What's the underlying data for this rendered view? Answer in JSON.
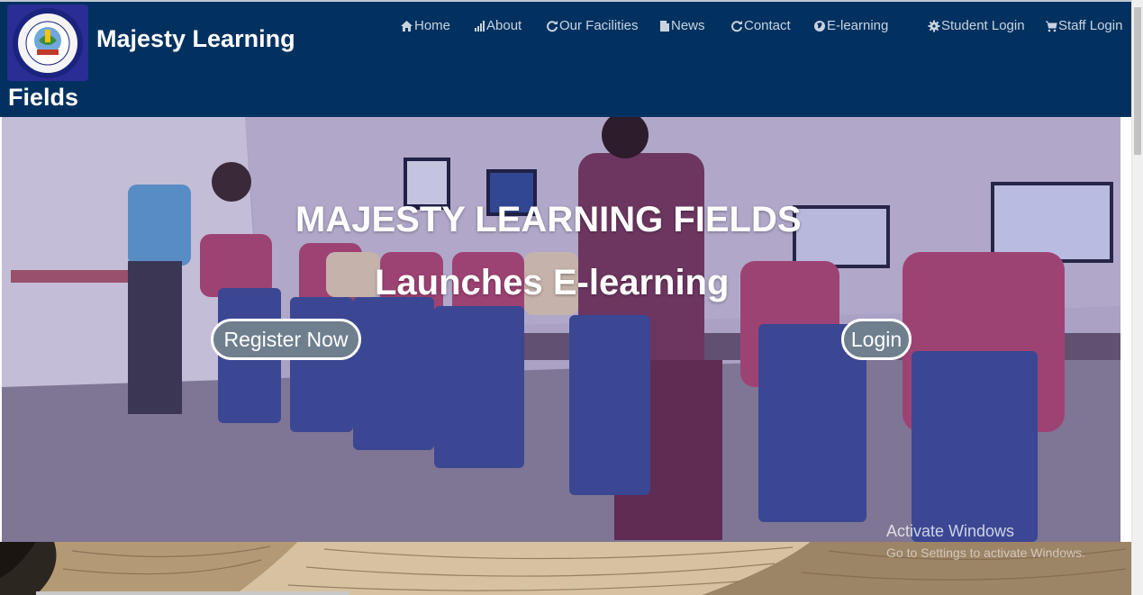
{
  "brand": {
    "line1": "Majesty Learning",
    "line2": "Fields",
    "logo_icon": "college-crest-logo"
  },
  "nav": [
    {
      "label": "Home",
      "icon": "home-icon"
    },
    {
      "label": "About",
      "icon": "bar-chart-icon"
    },
    {
      "label": "Our Facilities",
      "icon": "refresh-icon"
    },
    {
      "label": "News",
      "icon": "document-icon"
    },
    {
      "label": "Contact",
      "icon": "refresh-icon"
    },
    {
      "label": "E-learning",
      "icon": "globe-icon"
    },
    {
      "label": "Student Login",
      "icon": "gear-icon"
    },
    {
      "label": "Staff Login",
      "icon": "shopping-cart-icon"
    }
  ],
  "hero": {
    "title": "MAJESTY LEARNING FIELDS",
    "subtitle": "Launches E-learning",
    "register_label": "Register Now",
    "login_label": "Login"
  },
  "watermark": {
    "title": "Activate Windows",
    "subtitle": "Go to Settings to activate Windows."
  },
  "colors": {
    "header_bg": "#02315f",
    "nav_text": "#c9d3e0",
    "button_bg": "#6f7f8e"
  }
}
